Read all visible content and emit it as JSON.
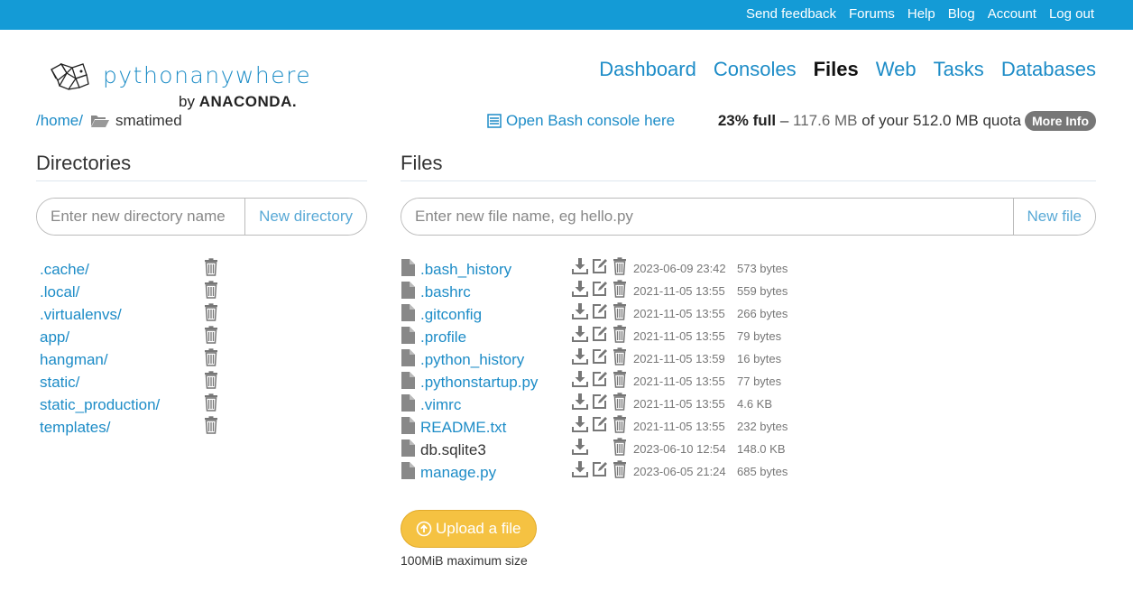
{
  "topnav": [
    "Send feedback",
    "Forums",
    "Help",
    "Blog",
    "Account",
    "Log out"
  ],
  "logo": {
    "text": "pythonanywhere",
    "by": "by",
    "brand": "ANACONDA."
  },
  "mainnav": [
    {
      "label": "Dashboard",
      "active": false
    },
    {
      "label": "Consoles",
      "active": false
    },
    {
      "label": "Files",
      "active": true
    },
    {
      "label": "Web",
      "active": false
    },
    {
      "label": "Tasks",
      "active": false
    },
    {
      "label": "Databases",
      "active": false
    }
  ],
  "breadcrumb": {
    "root": "/home/",
    "current": "smatimed"
  },
  "bash_link": "Open Bash console here",
  "quota": {
    "percent": "23% full",
    "dash": "–",
    "used": "117.6 MB",
    "of_text": "of your 512.0 MB quota",
    "more_info": "More Info"
  },
  "directories": {
    "title": "Directories",
    "input_placeholder": "Enter new directory name",
    "new_button": "New directory",
    "items": [
      ".cache/",
      ".local/",
      ".virtualenvs/",
      "app/",
      "hangman/",
      "static/",
      "static_production/",
      "templates/"
    ]
  },
  "files": {
    "title": "Files",
    "input_placeholder": "Enter new file name, eg hello.py",
    "new_button": "New file",
    "items": [
      {
        "name": ".bash_history",
        "date": "2023-06-09 23:42",
        "size": "573 bytes",
        "editable": true,
        "link": true
      },
      {
        "name": ".bashrc",
        "date": "2021-11-05 13:55",
        "size": "559 bytes",
        "editable": true,
        "link": true
      },
      {
        "name": ".gitconfig",
        "date": "2021-11-05 13:55",
        "size": "266 bytes",
        "editable": true,
        "link": true
      },
      {
        "name": ".profile",
        "date": "2021-11-05 13:55",
        "size": "79 bytes",
        "editable": true,
        "link": true
      },
      {
        "name": ".python_history",
        "date": "2021-11-05 13:59",
        "size": "16 bytes",
        "editable": true,
        "link": true
      },
      {
        "name": ".pythonstartup.py",
        "date": "2021-11-05 13:55",
        "size": "77 bytes",
        "editable": true,
        "link": true
      },
      {
        "name": ".vimrc",
        "date": "2021-11-05 13:55",
        "size": "4.6 KB",
        "editable": true,
        "link": true
      },
      {
        "name": "README.txt",
        "date": "2021-11-05 13:55",
        "size": "232 bytes",
        "editable": true,
        "link": true
      },
      {
        "name": "db.sqlite3",
        "date": "2023-06-10 12:54",
        "size": "148.0 KB",
        "editable": false,
        "link": false
      },
      {
        "name": "manage.py",
        "date": "2023-06-05 21:24",
        "size": "685 bytes",
        "editable": true,
        "link": true
      }
    ],
    "upload_button": "Upload a file",
    "max_size": "100MiB maximum size"
  },
  "icons": {
    "folder": "folder-open-icon",
    "file": "file-icon",
    "download": "download-icon",
    "edit": "edit-icon",
    "delete": "trash-icon",
    "console": "console-icon",
    "upload": "upload-circle-icon"
  },
  "colors": {
    "topbar": "#149bd6",
    "link": "#1d8cc7",
    "upload": "#f5c242",
    "badge": "#777777"
  }
}
